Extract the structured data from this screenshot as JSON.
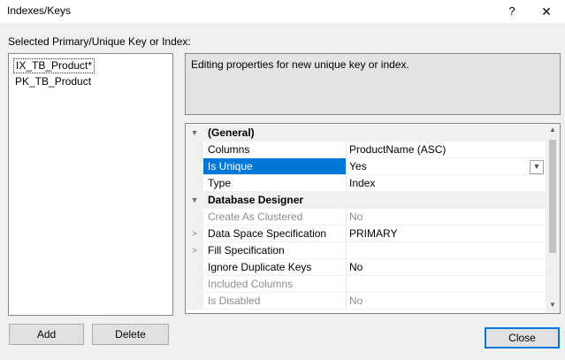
{
  "window": {
    "title": "Indexes/Keys",
    "help_glyph": "?",
    "close_glyph": "✕"
  },
  "selector": {
    "label": "Selected Primary/Unique Key or Index:",
    "items": [
      {
        "label": "IX_TB_Product*",
        "selected": true
      },
      {
        "label": "PK_TB_Product",
        "selected": false
      }
    ]
  },
  "description": "Editing properties for new unique key or index.",
  "properties": {
    "general": {
      "label": "(General)",
      "columns": {
        "name": "Columns",
        "value": "ProductName (ASC)"
      },
      "is_unique": {
        "name": "Is Unique",
        "value": "Yes"
      },
      "type": {
        "name": "Type",
        "value": "Index"
      }
    },
    "database_designer": {
      "label": "Database Designer",
      "create_as_clustered": {
        "name": "Create As Clustered",
        "value": "No"
      },
      "data_space_spec": {
        "name": "Data Space Specification",
        "value": "PRIMARY"
      },
      "fill_spec": {
        "name": "Fill Specification",
        "value": ""
      },
      "ignore_duplicate_keys": {
        "name": "Ignore Duplicate Keys",
        "value": "No"
      },
      "included_columns": {
        "name": "Included Columns",
        "value": ""
      },
      "is_disabled": {
        "name": "Is Disabled",
        "value": "No"
      }
    }
  },
  "buttons": {
    "add": "Add",
    "delete": "Delete",
    "close": "Close"
  },
  "colors": {
    "selection": "#0078d7",
    "window_bg": "#f0f0f0",
    "dimmed_text": "#8d8d8d"
  }
}
